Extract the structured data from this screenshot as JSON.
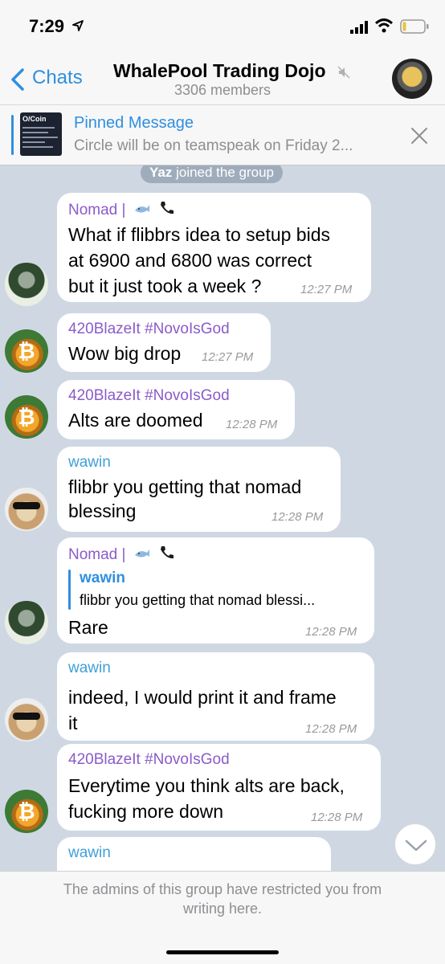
{
  "status_bar": {
    "time": "7:29"
  },
  "nav": {
    "back_label": "Chats",
    "title": "WhalePool Trading Dojo",
    "subtitle": "3306 members"
  },
  "pinned": {
    "title": "Pinned Message",
    "text": "Circle will be on teamspeak on Friday 2...",
    "thumb_label": "O/Coin"
  },
  "system": {
    "join_user": "Yaz",
    "join_text": " joined the group"
  },
  "messages": [
    {
      "sender": "Nomad |",
      "lines": [
        "What if flibbrs idea to setup bids",
        "at 6900 and 6800 was correct",
        "but it just took a week ?"
      ],
      "time": "12:27 PM"
    },
    {
      "sender": "420BlazeIt #NovoIsGod",
      "lines": [
        "Wow big drop"
      ],
      "time": "12:27 PM"
    },
    {
      "sender": "420BlazeIt #NovoIsGod",
      "lines": [
        "Alts are doomed"
      ],
      "time": "12:28 PM"
    },
    {
      "sender": "wawin",
      "lines": [
        "flibbr you getting that nomad",
        "blessing"
      ],
      "time": "12:28 PM"
    },
    {
      "sender": "Nomad |",
      "reply_name": "wawin",
      "reply_text": "flibbr you getting that nomad blessi...",
      "lines": [
        "Rare"
      ],
      "time": "12:28 PM"
    },
    {
      "sender": "wawin",
      "lines": [
        "indeed, I would print it and frame",
        "it"
      ],
      "time": "12:28 PM"
    },
    {
      "sender": "420BlazeIt #NovoIsGod",
      "lines": [
        "Everytime you think alts are back,",
        "fucking more down"
      ],
      "time": "12:28 PM"
    },
    {
      "sender": "wawin",
      "lines": [],
      "time": ""
    }
  ],
  "footer": {
    "restricted_line1": "The admins of this group have restricted you from",
    "restricted_line2": "writing here."
  },
  "colors": {
    "accent": "#2f8fe0",
    "sender_purple": "#8a5bc9",
    "sender_blue": "#3fa0d8",
    "chat_bg": "#cfd8e2"
  }
}
